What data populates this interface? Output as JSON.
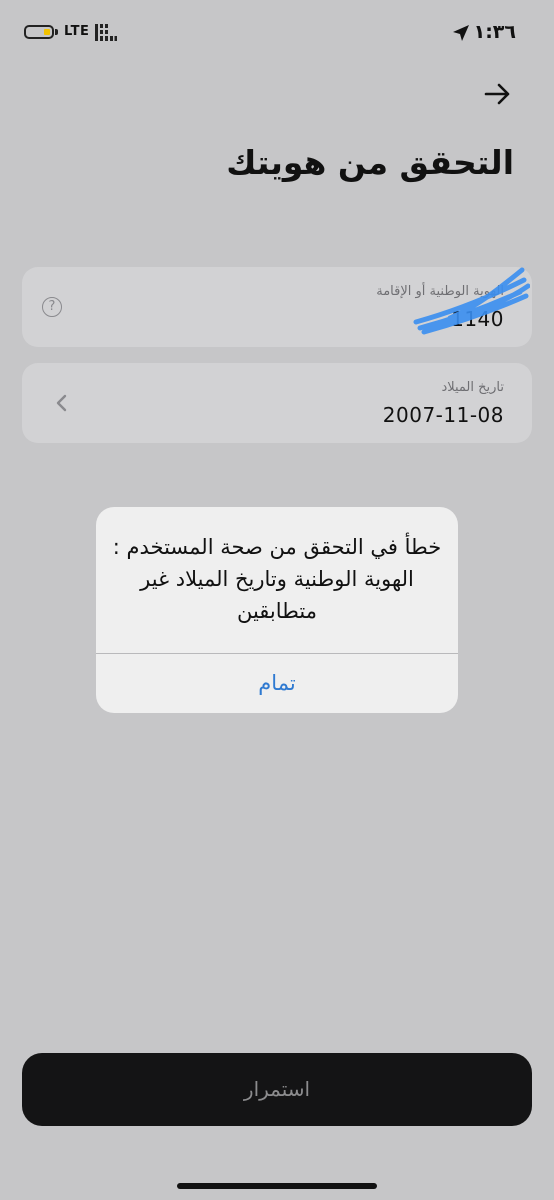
{
  "status_bar": {
    "time": "١:٣٦",
    "network": "LTE",
    "icons": [
      "location-arrow-icon",
      "signal-bars-icon",
      "battery-icon"
    ],
    "battery_color": "#f2c200"
  },
  "header": {
    "back_icon": "arrow-right-icon",
    "title": "التحقق من هويتك"
  },
  "form": {
    "id_field": {
      "label": "الهوية الوطنية أو الإقامة",
      "value": "1140",
      "help_icon": "?"
    },
    "dob_field": {
      "label": "تاريخ الميلاد",
      "value": "2007-11-08",
      "icon": "chevron-left-icon"
    }
  },
  "alert": {
    "message": "خطأ في التحقق من صحة المستخدم : الهوية الوطنية وتاريخ الميلاد غير متطابقين",
    "button_label": "تمام",
    "button_color": "#2f7ad1"
  },
  "footer": {
    "continue_label": "استمرار"
  }
}
